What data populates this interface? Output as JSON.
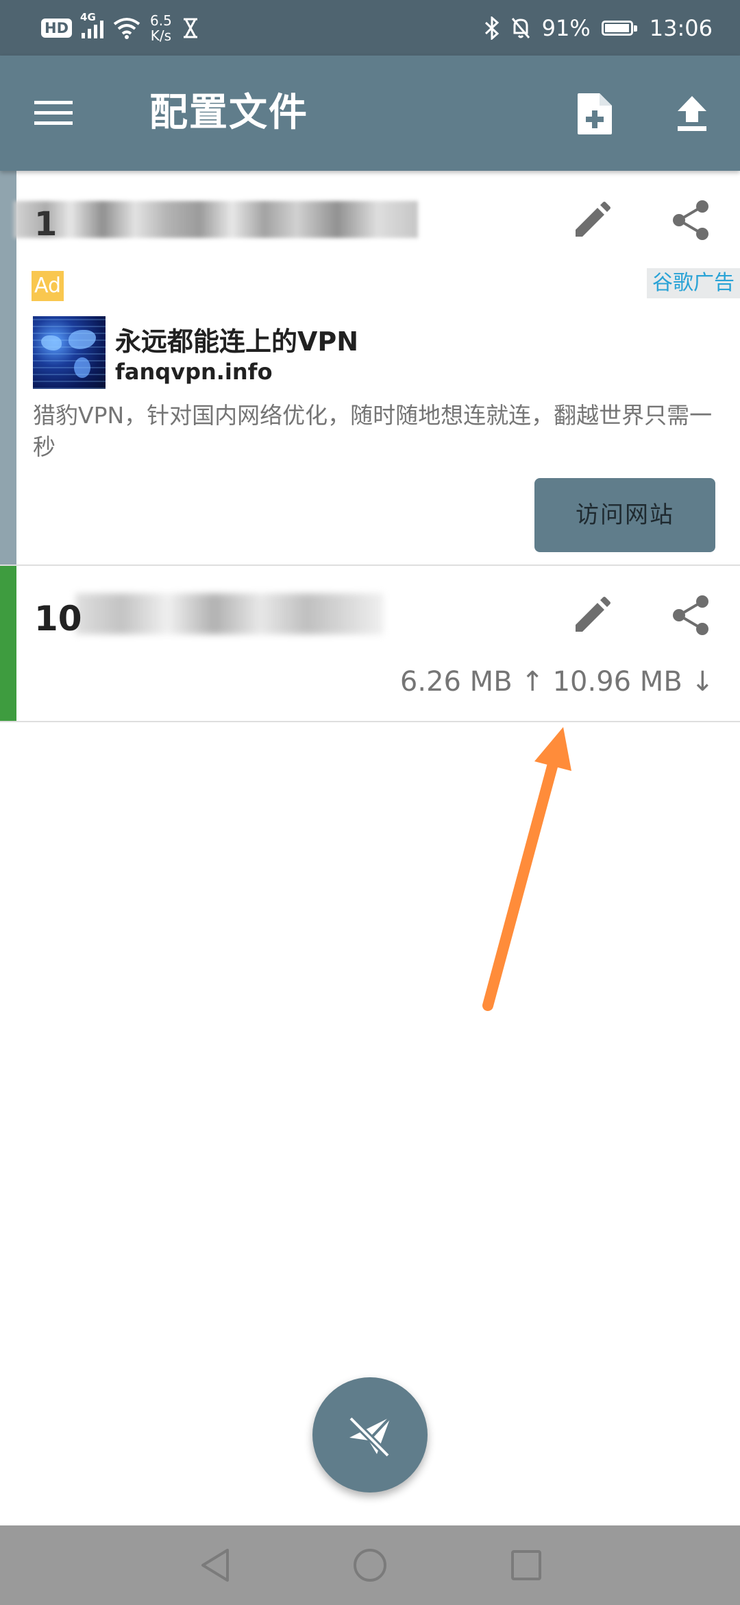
{
  "status_bar": {
    "hd": "HD",
    "network": "4G",
    "speed_value": "6.5",
    "speed_unit": "K/s",
    "battery": "91%",
    "time": "13:06"
  },
  "app_bar": {
    "title": "配置文件",
    "icons": [
      "menu-icon",
      "new-file-icon",
      "upload-icon"
    ]
  },
  "profiles": [
    {
      "name_visible": "1",
      "stripe_color": "#90a4ae"
    },
    {
      "name_visible": "10",
      "stripe_color": "#3e9c3f",
      "traffic": "6.26 MB ↑ 10.96 MB ↓"
    }
  ],
  "ad": {
    "badge": "Ad",
    "provider": "谷歌广告",
    "title": "永远都能连上的VPN",
    "domain": "fanqvpn.info",
    "description": "猎豹VPN，针对国内网络优化，随时随地想连就连，翻越世界只需一秒",
    "button": "访问网站"
  },
  "colors": {
    "primary": "#607d8b",
    "status_bar": "#4f6470",
    "accent_arrow": "#ff8c3a",
    "active_stripe": "#3e9c3f"
  }
}
